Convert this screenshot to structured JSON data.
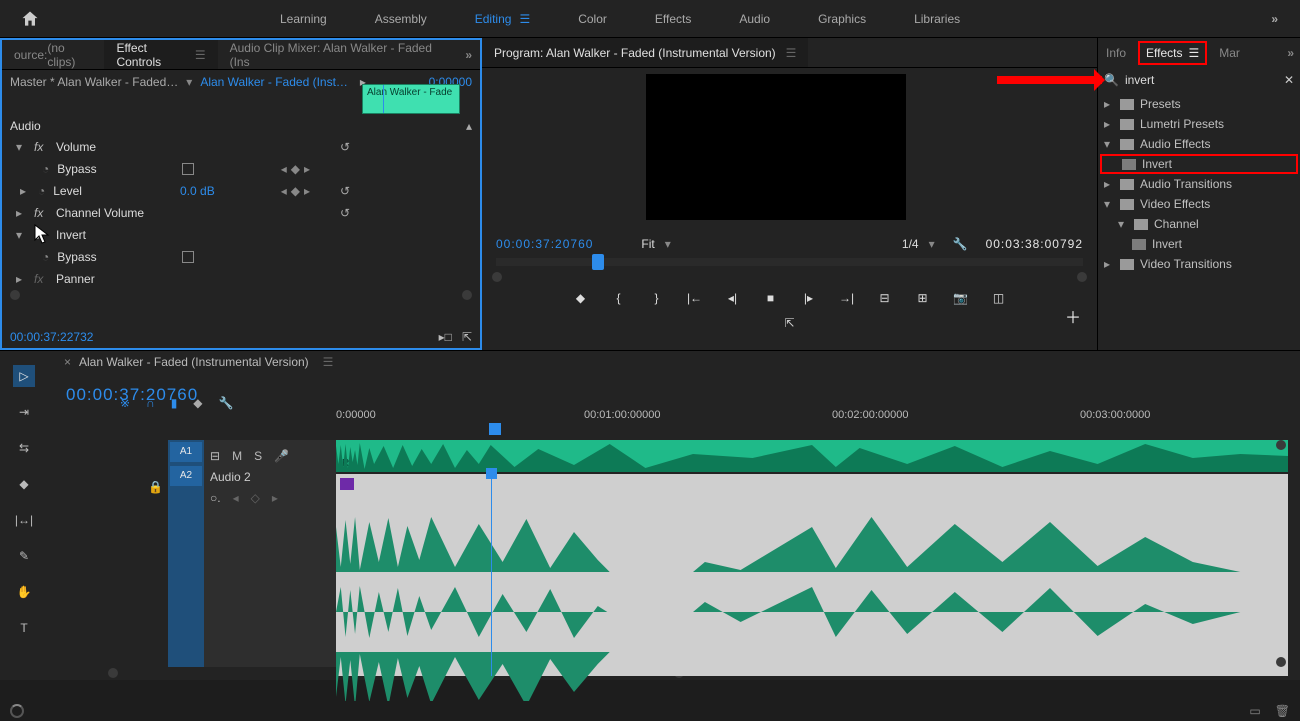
{
  "topbar": {
    "tabs": [
      "Learning",
      "Assembly",
      "Editing",
      "Color",
      "Effects",
      "Audio",
      "Graphics",
      "Libraries"
    ],
    "activeIndex": 2
  },
  "sourcePanel": {
    "source_tab": "(no clips)",
    "effect_controls_tab": "Effect Controls",
    "audio_clip_mixer_tab": "Audio Clip Mixer: Alan Walker - Faded (Ins"
  },
  "effectControls": {
    "master_clip": "Master * Alan Walker - Faded…",
    "instance_clip": "Alan Walker - Faded (Inst…",
    "mini_start": "0:00000",
    "clip_label": "Alan Walker - Fade",
    "section": "Audio",
    "fx": {
      "volume_label": "Volume",
      "bypass_label": "Bypass",
      "level_label": "Level",
      "level_value": "0.0 dB",
      "channel_volume_label": "Channel Volume",
      "invert_label": "Invert",
      "panner_label": "Panner"
    },
    "footer_tc": "00:00:37:22732"
  },
  "program": {
    "title": "Program: Alan Walker - Faded (Instrumental Version)",
    "tc_current": "00:00:37:20760",
    "fit_label": "Fit",
    "scale_label": "1/4",
    "tc_total": "00:03:38:00792"
  },
  "rightPanel": {
    "tabs": {
      "info": "Info",
      "effects": "Effects",
      "mar": "Mar"
    },
    "search_value": "invert",
    "nodes": {
      "presets": "Presets",
      "lumetri": "Lumetri Presets",
      "audio_effects": "Audio Effects",
      "invert": "Invert",
      "audio_transitions": "Audio Transitions",
      "video_effects": "Video Effects",
      "channel": "Channel",
      "invert_v": "Invert",
      "video_transitions": "Video Transitions"
    }
  },
  "timeline": {
    "sequence_name": "Alan Walker - Faded (Instrumental Version)",
    "tc": "00:00:37:20760",
    "ruler": [
      "0:00000",
      "00:01:00:00000",
      "00:02:00:00000",
      "00:03:00:0000"
    ],
    "a1": "A1",
    "a2": "A2",
    "track_label": "Audio 2",
    "track_btns": {
      "m": "M",
      "s": "S"
    }
  }
}
